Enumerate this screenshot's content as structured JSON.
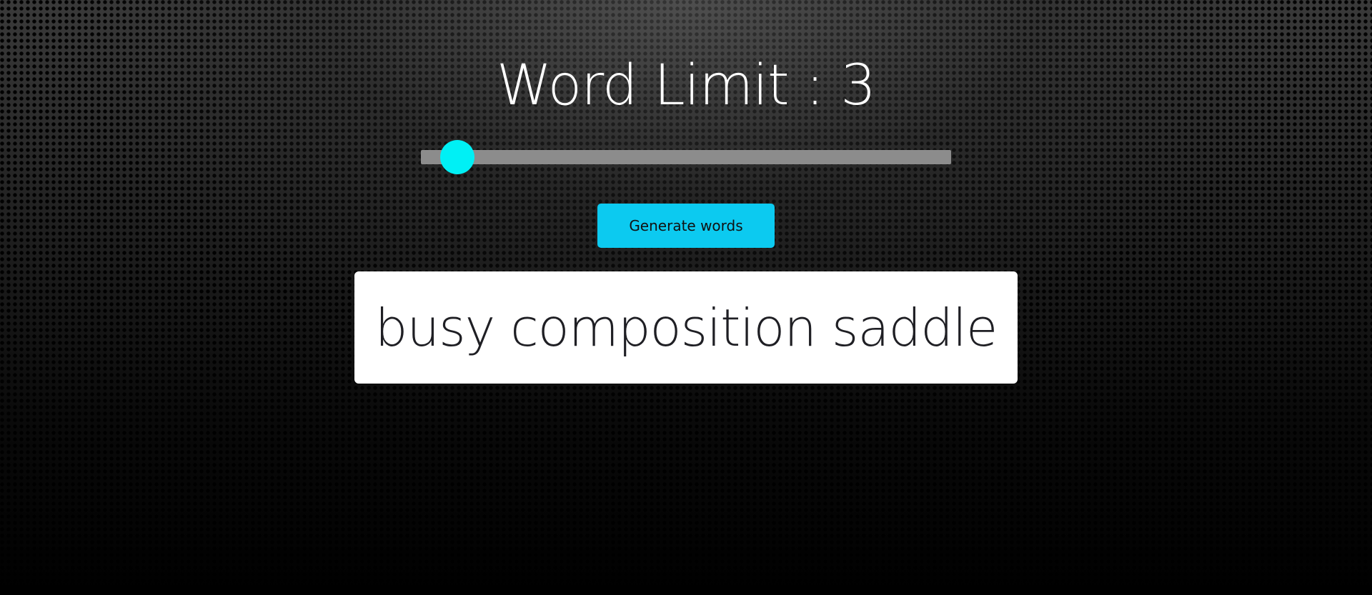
{
  "header": {
    "title": "Word Limit : 3"
  },
  "slider": {
    "value": 3,
    "track_color": "#8c8c8c",
    "thumb_color": "#00f0f5"
  },
  "toolbar": {
    "generate_label": "Generate words",
    "button_color": "#0ccaf0"
  },
  "output": {
    "text": "busy composition saddle"
  }
}
